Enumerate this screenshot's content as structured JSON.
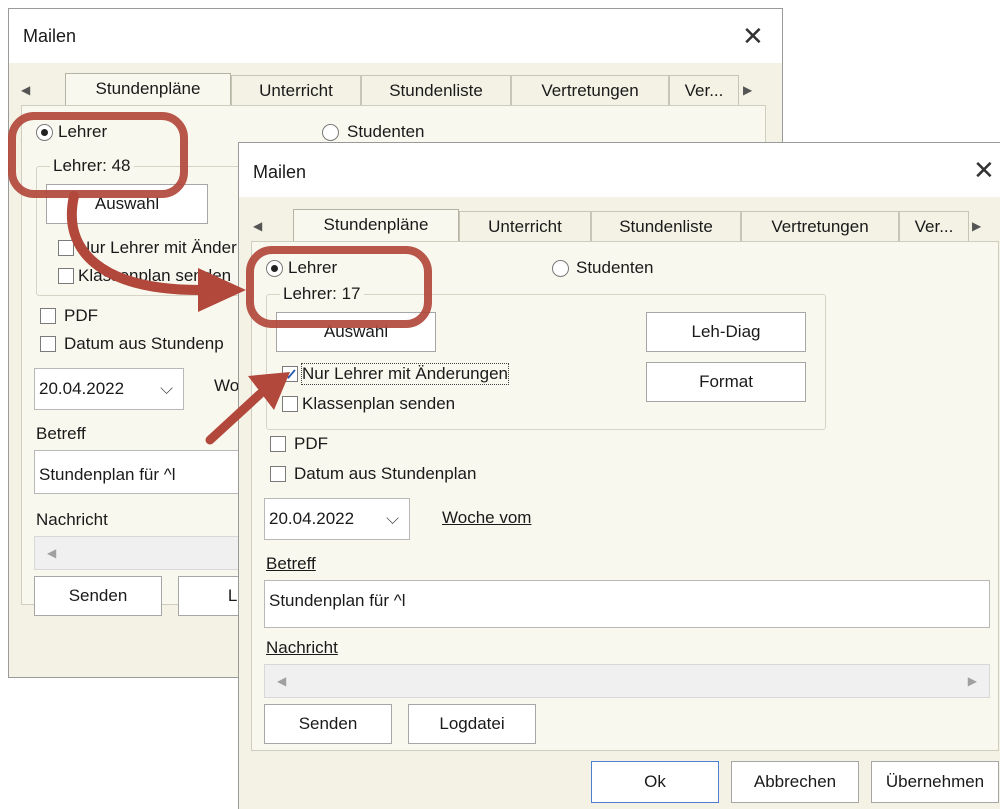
{
  "back_dialog": {
    "title": "Mailen",
    "tabs": [
      "Stundenpläne",
      "Unterricht",
      "Stundenliste",
      "Vertretungen",
      "Ver..."
    ],
    "radio_lehrer": "Lehrer",
    "radio_studenten": "Studenten",
    "group_label": "Lehrer: 48",
    "auswahl_button": "Auswahl",
    "chk_nur_lehrer": "Nur Lehrer mit Änder",
    "chk_klassenplan": "Klassenplan senden",
    "chk_pdf": "PDF",
    "chk_datum": "Datum aus Stundenp",
    "date_value": "20.04.2022",
    "woche_label": "Wo",
    "betreff_label": "Betreff",
    "betreff_value": "Stundenplan für ^l",
    "nachricht_label": "Nachricht",
    "senden_button": "Senden",
    "logdatei_button": "Log"
  },
  "front_dialog": {
    "title": "Mailen",
    "tabs": [
      "Stundenpläne",
      "Unterricht",
      "Stundenliste",
      "Vertretungen",
      "Ver..."
    ],
    "radio_lehrer": "Lehrer",
    "radio_studenten": "Studenten",
    "group_label": "Lehrer: 17",
    "auswahl_button": "Auswahl",
    "leh_diag_button": "Leh-Diag",
    "format_button": "Format",
    "chk_nur_lehrer": "Nur Lehrer mit Änderungen",
    "chk_nur_lehrer_checked": true,
    "chk_klassenplan": "Klassenplan senden",
    "chk_pdf": "PDF",
    "chk_datum": "Datum aus Stundenplan",
    "date_value": "20.04.2022",
    "woche_label": "Woche vom",
    "betreff_label": "Betreff",
    "betreff_value": "Stundenplan für ^l",
    "nachricht_label": "Nachricht",
    "senden_button": "Senden",
    "logdatei_button": "Logdatei",
    "ok_button": "Ok",
    "abbrechen_button": "Abbrechen",
    "uebernehmen_button": "Übernehmen"
  },
  "colors": {
    "annotation": "#b1483b",
    "dialog_bg": "#f3f2e4"
  }
}
